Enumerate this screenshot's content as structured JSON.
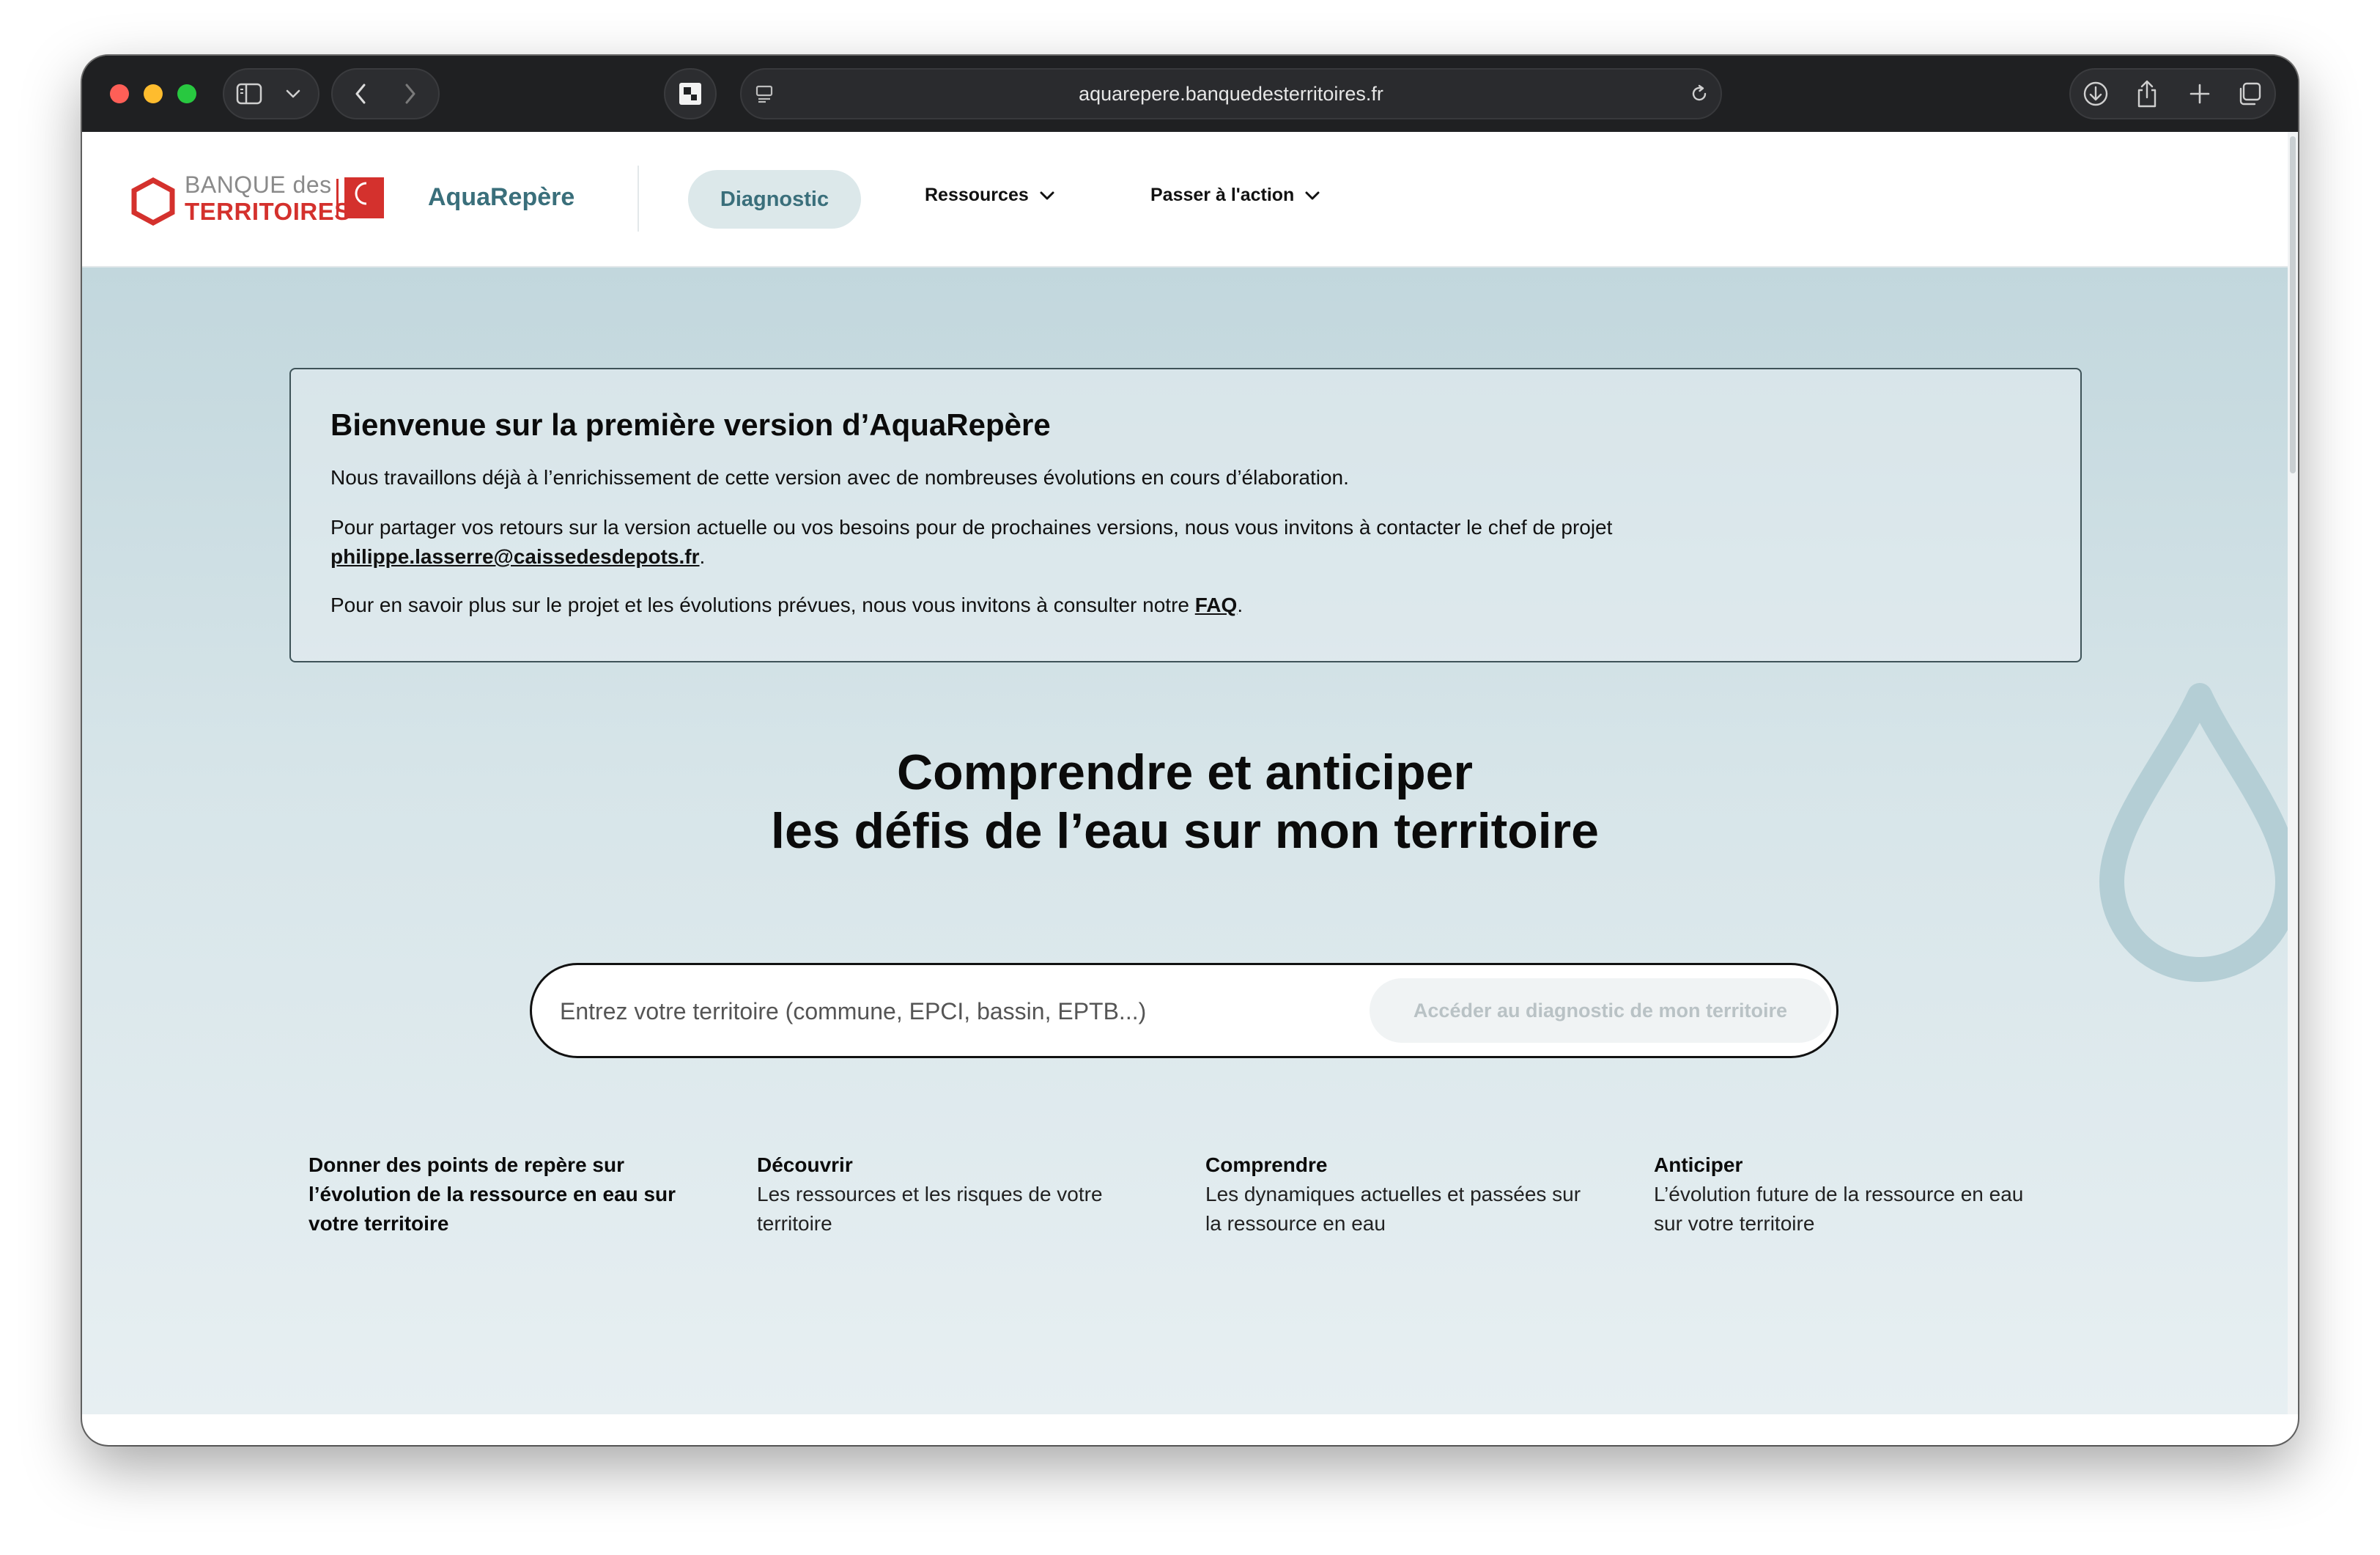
{
  "browser": {
    "url": "aquarepere.banquedesterritoires.fr"
  },
  "nav": {
    "logo_top": "BANQUE des",
    "logo_bottom": "TERRITOIRES",
    "brand": "AquaRepère",
    "diagnostic": "Diagnostic",
    "ressources": "Ressources",
    "passer": "Passer à l'action"
  },
  "banner": {
    "title": "Bienvenue sur la première version d’AquaRepère",
    "p1": "Nous travaillons déjà à l’enrichissement de cette version avec de nombreuses évolutions en cours d’élaboration.",
    "p2": "Pour partager vos retours sur la version actuelle ou vos besoins pour de prochaines versions, nous vous invitons à contacter le chef de projet",
    "email": "philippe.lasserre@caissedesdepots.fr",
    "p3": "Pour en savoir plus sur le projet et les évolutions prévues, nous vous invitons à consulter notre",
    "faq": "FAQ"
  },
  "hero": {
    "title_line1": "Comprendre et anticiper",
    "title_line2": "les défis de l’eau sur mon territoire"
  },
  "search": {
    "placeholder": "Entrez votre territoire (commune, EPCI, bassin, EPTB...)",
    "button": "Accéder au diagnostic de mon territoire"
  },
  "features": [
    {
      "title": "Donner des points de repère sur l’évolution de la ressource en eau sur votre territoire",
      "text": ""
    },
    {
      "title": "Découvrir",
      "text": "Les ressources et les risques de votre territoire"
    },
    {
      "title": "Comprendre",
      "text": "Les dynamiques actuelles et passées sur la ressource en eau"
    },
    {
      "title": "Anticiper",
      "text": "L’évolution future de la ressource en eau sur votre territoire"
    }
  ],
  "colors": {
    "brand_teal": "#3a6f7b",
    "logo_red": "#d4312d",
    "hero_bg": "#c2d7dd"
  }
}
